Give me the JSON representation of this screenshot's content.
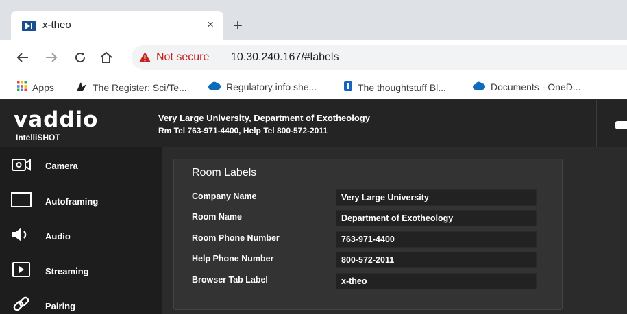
{
  "browser": {
    "tab": {
      "title": "x-theo",
      "close": "×"
    },
    "new_tab": "+",
    "address": {
      "security_text": "Not secure",
      "url": "10.30.240.167/#labels"
    },
    "bookmarks": [
      {
        "label": "Apps",
        "icon": "apps-grid-icon"
      },
      {
        "label": "The Register: Sci/Te...",
        "icon": "register-icon"
      },
      {
        "label": "Regulatory info she...",
        "icon": "cloud-icon"
      },
      {
        "label": "The thoughtstuff Bl...",
        "icon": "bookmark-blue-icon"
      },
      {
        "label": "Documents - OneD...",
        "icon": "cloud-icon"
      }
    ]
  },
  "header": {
    "brand": "vaddio",
    "product": "IntelliSHOT",
    "line1": "Very Large University, Department of Exotheology",
    "line2": "Rm Tel 763-971-4400, Help Tel 800-572-2011"
  },
  "sidebar": {
    "items": [
      {
        "label": "Camera",
        "icon": "camera-icon"
      },
      {
        "label": "Autoframing",
        "icon": "frame-icon"
      },
      {
        "label": "Audio",
        "icon": "speaker-icon"
      },
      {
        "label": "Streaming",
        "icon": "play-icon"
      },
      {
        "label": "Pairing",
        "icon": "link-icon"
      }
    ]
  },
  "room_labels": {
    "title": "Room Labels",
    "fields": [
      {
        "label": "Company Name",
        "value": "Very Large University"
      },
      {
        "label": "Room Name",
        "value": "Department of Exotheology"
      },
      {
        "label": "Room Phone Number",
        "value": "763-971-4400"
      },
      {
        "label": "Help Phone Number",
        "value": "800-572-2011"
      },
      {
        "label": "Browser Tab Label",
        "value": "x-theo"
      }
    ]
  },
  "colors": {
    "accent_warning": "#c5221f",
    "background": "#2b2b2b",
    "sidebar": "#1d1d1d",
    "header": "#242424"
  }
}
